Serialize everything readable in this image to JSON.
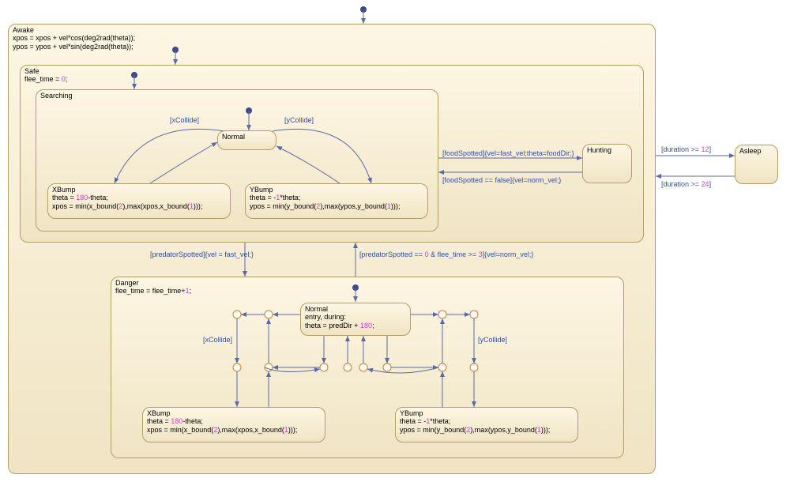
{
  "chart_data": {
    "type": "statechart",
    "states": {
      "Awake": {
        "entry": [
          "xpos = xpos + vel*cos(deg2rad(theta));",
          "ypos = ypos + vel*sin(deg2rad(theta));"
        ],
        "contains": [
          "Safe",
          "Danger"
        ]
      },
      "Asleep": {
        "entry": [],
        "contains": []
      },
      "Safe": {
        "entry": [
          "flee_time = 0;"
        ],
        "contains": [
          "Searching",
          "Hunting"
        ]
      },
      "Searching": {
        "contains": [
          "Normal",
          "XBump",
          "YBump"
        ]
      },
      "Hunting": {
        "contains": []
      },
      "Searching.Normal": {},
      "Searching.XBump": {
        "entry": [
          "theta = 180-theta;",
          "xpos = min(x_bound(2),max(xpos,x_bound(1)));"
        ]
      },
      "Searching.YBump": {
        "entry": [
          "theta = -1*theta;",
          "ypos = min(y_bound(2),max(ypos,y_bound(1)));"
        ]
      },
      "Danger": {
        "entry": [
          "flee_time = flee_time+1;"
        ],
        "contains": [
          "Normal",
          "XBump",
          "YBump"
        ]
      },
      "Danger.Normal": {
        "entry_during": [
          "theta = predDir + 180;"
        ]
      },
      "Danger.XBump": {
        "entry": [
          "theta = 180-theta;",
          "xpos = min(x_bound(2),max(xpos,x_bound(1)));"
        ]
      },
      "Danger.YBump": {
        "entry": [
          "theta = -1*theta;",
          "ypos = min(y_bound(2),max(ypos,y_bound(1)));"
        ]
      }
    },
    "transitions": [
      {
        "from": "__root__",
        "to": "Awake",
        "default": true
      },
      {
        "from": "Awake",
        "to": "Asleep",
        "cond": "duration >= 12"
      },
      {
        "from": "Asleep",
        "to": "Awake",
        "cond": "duration >= 24"
      },
      {
        "from": "Awake",
        "to": "Safe",
        "default": true
      },
      {
        "from": "Safe",
        "to": "Danger",
        "cond": "predatorSpotted",
        "action": "vel = fast_vel;"
      },
      {
        "from": "Danger",
        "to": "Safe",
        "cond": "predatorSpotted == 0 & flee_time >= 3",
        "action": "vel=norm_vel;"
      },
      {
        "from": "Safe",
        "to": "Searching",
        "default": true
      },
      {
        "from": "Searching",
        "to": "Hunting",
        "cond": "foodSpotted",
        "action": "vel=fast_vel;theta=foodDir;"
      },
      {
        "from": "Hunting",
        "to": "Searching",
        "cond": "foodSpotted == false",
        "action": "vel=norm_vel;"
      },
      {
        "from": "Searching",
        "to": "Normal",
        "default": true
      },
      {
        "from": "Searching.Normal",
        "to": "Searching.XBump",
        "cond": "xCollide"
      },
      {
        "from": "Searching.XBump",
        "to": "Searching.Normal"
      },
      {
        "from": "Searching.Normal",
        "to": "Searching.YBump",
        "cond": "yCollide"
      },
      {
        "from": "Searching.YBump",
        "to": "Searching.Normal"
      },
      {
        "from": "Danger",
        "to": "Normal",
        "default": true
      },
      {
        "from": "Danger.Normal",
        "to": "Danger.XBump",
        "cond": "xCollide",
        "via": "junction"
      },
      {
        "from": "Danger.XBump",
        "to": "Danger.Normal",
        "via": "junction"
      },
      {
        "from": "Danger.Normal",
        "to": "Danger.YBump",
        "cond": "yCollide",
        "via": "junction"
      },
      {
        "from": "Danger.YBump",
        "to": "Danger.Normal",
        "via": "junction"
      }
    ]
  },
  "labels": {
    "awake": "Awake",
    "awake_l1": "xpos = xpos + vel*cos(deg2rad(theta));",
    "awake_l2": "ypos = ypos + vel*sin(deg2rad(theta));",
    "asleep": "Asleep",
    "safe": "Safe",
    "safe_l1_a": "flee_time = ",
    "safe_l1_n": "0",
    "safe_l1_b": ";",
    "searching": "Searching",
    "hunting": "Hunting",
    "normal": "Normal",
    "xbump": "XBump",
    "xbump_l1_a": "theta = ",
    "xbump_l1_n": "180",
    "xbump_l1_b": "-theta;",
    "xbump_l2_a": "xpos = min(x_bound(",
    "xbump_l2_n1": "2",
    "xbump_l2_b": "),max(xpos,x_bound(",
    "xbump_l2_n2": "1",
    "xbump_l2_c": ")));",
    "ybump": "YBump",
    "ybump_l1_a": "theta = -",
    "ybump_l1_n": "1",
    "ybump_l1_b": "*theta;",
    "ybump_l2_a": "ypos = min(y_bound(",
    "ybump_l2_n1": "2",
    "ybump_l2_b": "),max(ypos,y_bound(",
    "ybump_l2_n2": "1",
    "ybump_l2_c": ")));",
    "danger": "Danger",
    "danger_l1_a": "flee_time = flee_time+",
    "danger_l1_n": "1",
    "danger_l1_b": ";",
    "dnormal_l1": "entry, during:",
    "dnormal_l2_a": "theta = predDir + ",
    "dnormal_l2_n": "180",
    "dnormal_l2_b": ";",
    "t_xcollide": "[xCollide]",
    "t_ycollide": "[yCollide]",
    "t_food1": "[foodSpotted]{vel=fast_vel;theta=foodDir;}",
    "t_food2": "[foodSpotted == false]{vel=norm_vel;}",
    "t_pred1": "[predatorSpotted]{vel = fast_vel;}",
    "t_pred2_a": "[predatorSpotted == ",
    "t_pred2_n1": "0",
    "t_pred2_b": " & flee_time >= ",
    "t_pred2_n2": "3",
    "t_pred2_c": "]{vel=norm_vel;}",
    "t_dur12_a": "[duration >= ",
    "t_dur12_n": "12",
    "t_dur12_b": "]",
    "t_dur24_a": "[duration >= ",
    "t_dur24_n": "24",
    "t_dur24_b": "]"
  }
}
